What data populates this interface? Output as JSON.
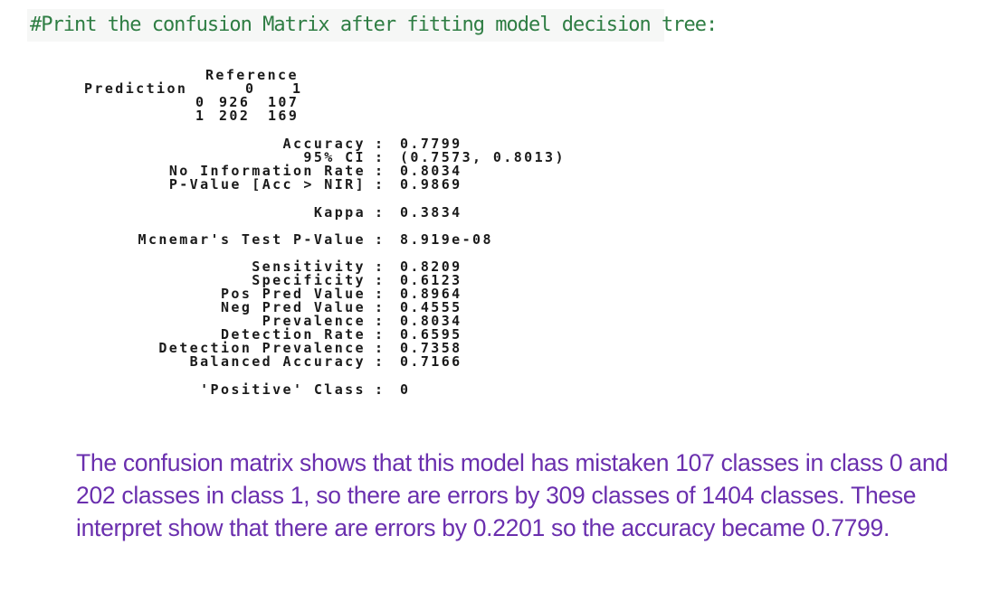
{
  "code_comment": "#Print the confusion Matrix after fitting model decision tree:",
  "confusion_matrix": {
    "reference_label": "Reference",
    "prediction_label": "Prediction",
    "column_headers": [
      "0",
      "1"
    ],
    "rows": [
      {
        "label": "0",
        "values": [
          "926",
          "107"
        ]
      },
      {
        "label": "1",
        "values": [
          "202",
          "169"
        ]
      }
    ]
  },
  "stats": [
    {
      "label": "Accuracy",
      "value": "0.7799"
    },
    {
      "label": "95% CI",
      "value": "(0.7573, 0.8013)"
    },
    {
      "label": "No Information Rate",
      "value": "0.8034"
    },
    {
      "label": "P-Value [Acc > NIR]",
      "value": "0.9869"
    },
    {
      "label": "Kappa",
      "value": "0.3834"
    },
    {
      "label": "Mcnemar's Test P-Value",
      "value": "8.919e-08"
    },
    {
      "label": "Sensitivity",
      "value": "0.8209"
    },
    {
      "label": "Specificity",
      "value": "0.6123"
    },
    {
      "label": "Pos Pred Value",
      "value": "0.8964"
    },
    {
      "label": "Neg Pred Value",
      "value": "0.4555"
    },
    {
      "label": "Prevalence",
      "value": "0.8034"
    },
    {
      "label": "Detection Rate",
      "value": "0.6595"
    },
    {
      "label": "Detection Prevalence",
      "value": "0.7358"
    },
    {
      "label": "Balanced Accuracy",
      "value": "0.7166"
    },
    {
      "label": "'Positive' Class",
      "value": "0"
    }
  ],
  "separator": ":",
  "interpretation": "The confusion matrix shows that this model has mistaken 107 classes in class 0 and 202 classes in class 1, so there are errors by 309 classes of 1404 classes. These interpret show that there are errors by 0.2201 so the accuracy became 0.7799.",
  "colors": {
    "code_comment": "#2e7d43",
    "code_background": "#f6f7f6",
    "interpretation_text": "#6a2fae",
    "output_text": "#1a1a1a"
  }
}
